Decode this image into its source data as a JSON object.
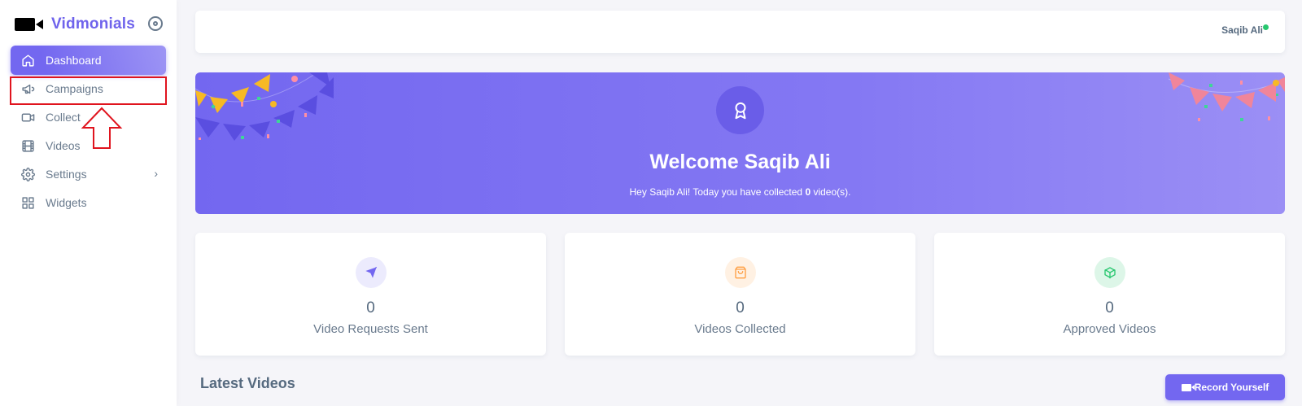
{
  "app": {
    "name": "Vidmonials"
  },
  "sidebar": {
    "items": [
      {
        "label": "Dashboard",
        "icon": "home-icon",
        "active": true
      },
      {
        "label": "Campaigns",
        "icon": "megaphone-icon"
      },
      {
        "label": "Collect",
        "icon": "video-camera-icon"
      },
      {
        "label": "Videos",
        "icon": "film-icon"
      },
      {
        "label": "Settings",
        "icon": "gear-icon",
        "has_submenu": true
      },
      {
        "label": "Widgets",
        "icon": "grid-icon"
      }
    ]
  },
  "header": {
    "user_name": "Saqib Ali",
    "status_color": "#28c76f"
  },
  "banner": {
    "title": "Welcome Saqib Ali",
    "sub_prefix": "Hey Saqib Ali! Today you have collected ",
    "sub_count": "0",
    "sub_suffix": " video(s)."
  },
  "stats": [
    {
      "value": "0",
      "label": "Video Requests Sent",
      "icon": "send-icon",
      "color": "#7367f0"
    },
    {
      "value": "0",
      "label": "Videos Collected",
      "icon": "shopping-bag-icon",
      "color": "#ff9f43"
    },
    {
      "value": "0",
      "label": "Approved Videos",
      "icon": "box-icon",
      "color": "#28c76f"
    }
  ],
  "latest": {
    "title": "Latest Videos",
    "record_button": "Record Yourself"
  },
  "colors": {
    "accent": "#7367f0",
    "annotation": "#e0141e"
  }
}
